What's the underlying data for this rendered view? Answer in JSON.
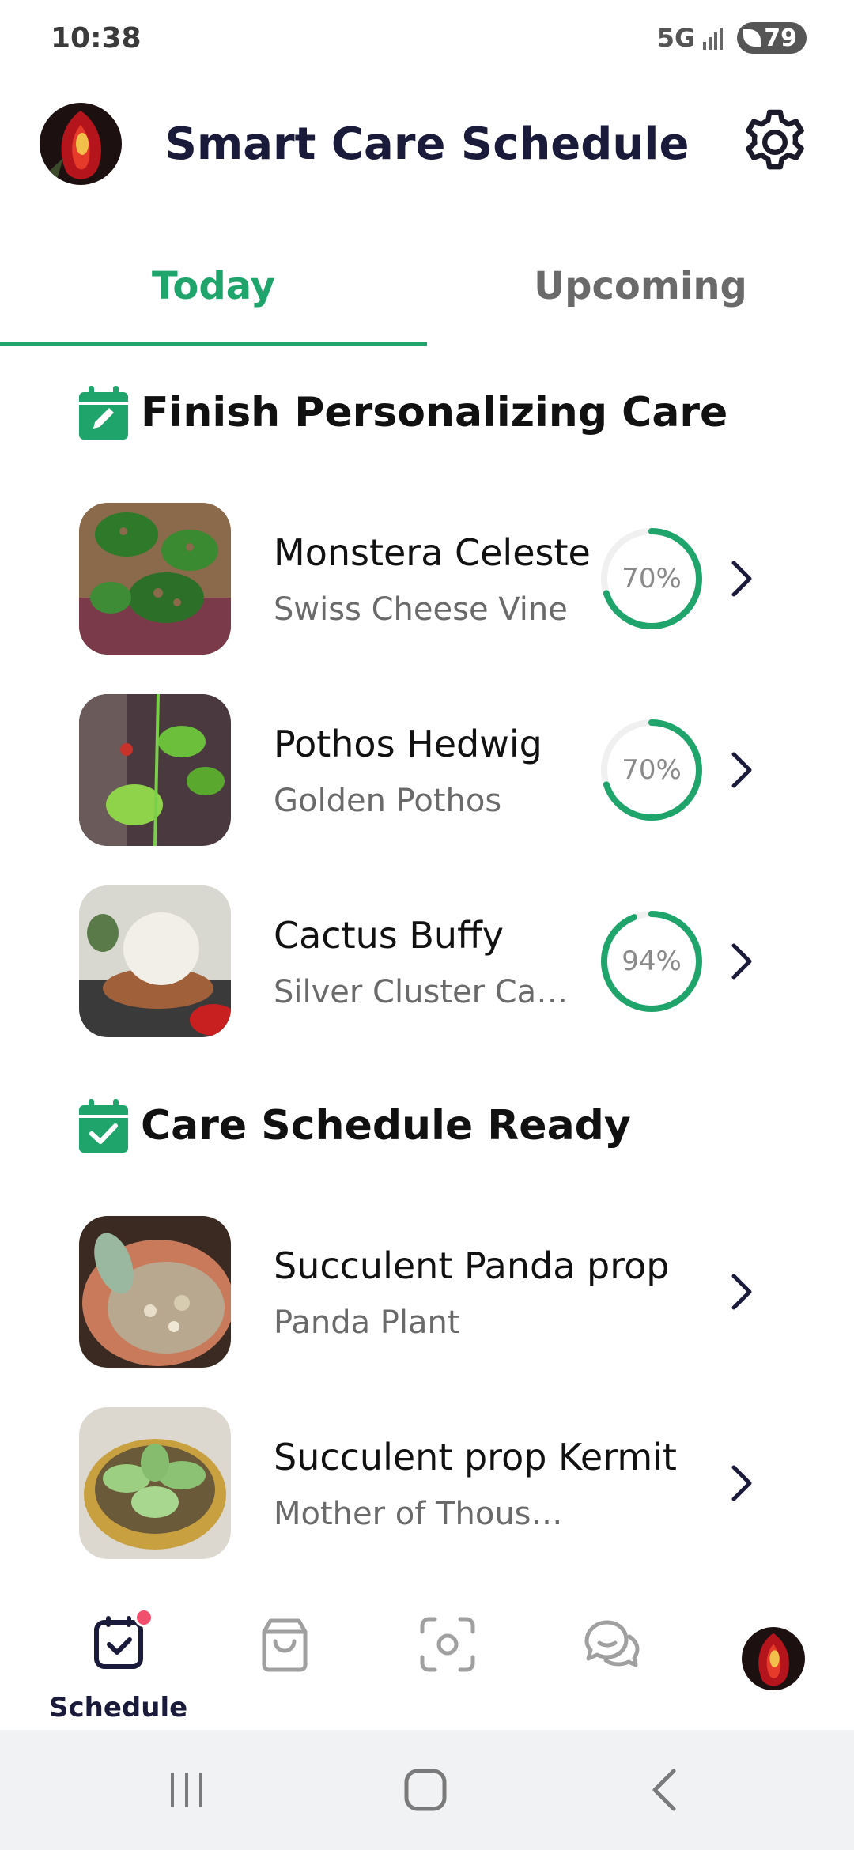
{
  "status_bar": {
    "time": "10:38",
    "network": "5G",
    "battery": "79"
  },
  "header": {
    "title": "Smart Care Schedule"
  },
  "tabs": [
    {
      "label": "Today",
      "active": true
    },
    {
      "label": "Upcoming",
      "active": false
    }
  ],
  "sections": [
    {
      "title": "Finish Personalizing Care",
      "icon": "calendar-edit-icon",
      "items": [
        {
          "name": "Monstera Celeste",
          "common": "Swiss Cheese Vine",
          "progress_label": "70%",
          "progress": 0.7
        },
        {
          "name": "Pothos Hedwig",
          "common": "Golden Pothos",
          "progress_label": "70%",
          "progress": 0.7
        },
        {
          "name": "Cactus Buffy",
          "common": "Silver Cluster Ca…",
          "progress_label": "94%",
          "progress": 0.94
        }
      ]
    },
    {
      "title": "Care Schedule Ready",
      "icon": "calendar-check-icon",
      "items": [
        {
          "name": "Succulent Panda prop",
          "common": "Panda Plant"
        },
        {
          "name": "Succulent prop Kermit",
          "common": "Mother of Thousands"
        }
      ]
    }
  ],
  "bottom_nav": {
    "schedule_label": "Schedule",
    "items": [
      "schedule-icon",
      "shop-bag-icon",
      "scan-icon",
      "chat-icon",
      "profile-avatar"
    ]
  },
  "colors": {
    "accent": "#1fa56b",
    "title": "#1a1a3a",
    "badge": "#f0506e",
    "muted": "#6a6a6a"
  }
}
